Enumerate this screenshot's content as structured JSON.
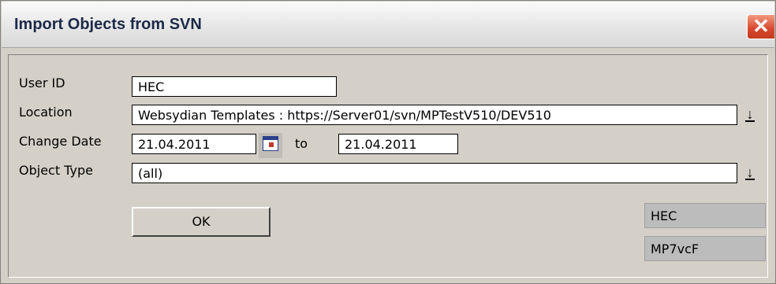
{
  "window": {
    "title": "Import Objects from SVN",
    "close_glyph": "✕"
  },
  "form": {
    "user_id": {
      "label": "User ID",
      "value": "HEC"
    },
    "location": {
      "label": "Location",
      "value": "Websydian Templates : https://Server01/svn/MPTestV510/DEV510"
    },
    "change_date": {
      "label": "Change Date",
      "from": "21.04.2011",
      "to_label": "to",
      "to": "21.04.2011"
    },
    "object_type": {
      "label": "Object Type",
      "value": "(all)"
    }
  },
  "buttons": {
    "ok": "OK"
  },
  "status": {
    "user": "HEC",
    "code": "MP7vcF"
  },
  "icons": {
    "dropdown": "dropdown-arrow-icon",
    "calendar": "calendar-icon"
  },
  "colors": {
    "title_text": "#1c2a47",
    "close_button": "#d8472c",
    "background": "#d4d0c8"
  }
}
